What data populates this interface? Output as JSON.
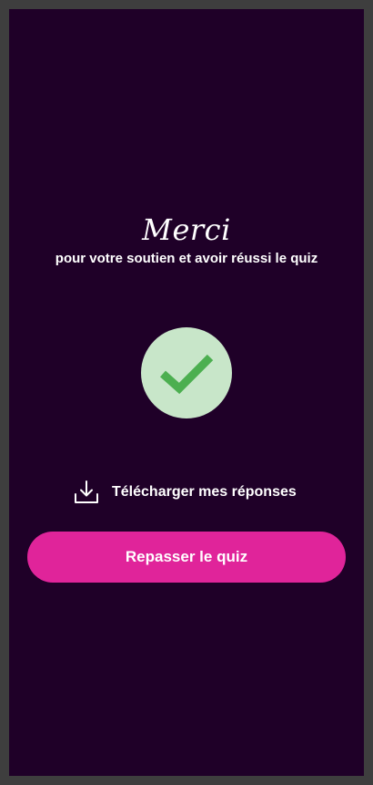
{
  "heading": "Merci",
  "subheading": "pour votre soutien et avoir réussi le quiz",
  "success_icon": "checkmark-icon",
  "download": {
    "icon": "download-icon",
    "label": "Télécharger mes réponses"
  },
  "retake_button": {
    "label": "Repasser le quiz"
  },
  "colors": {
    "background": "#1f0028",
    "frame": "#3e3e3e",
    "accent": "#e0249a",
    "success_circle": "#c8e6c9",
    "success_check": "#4caf50",
    "text": "#ffffff"
  }
}
